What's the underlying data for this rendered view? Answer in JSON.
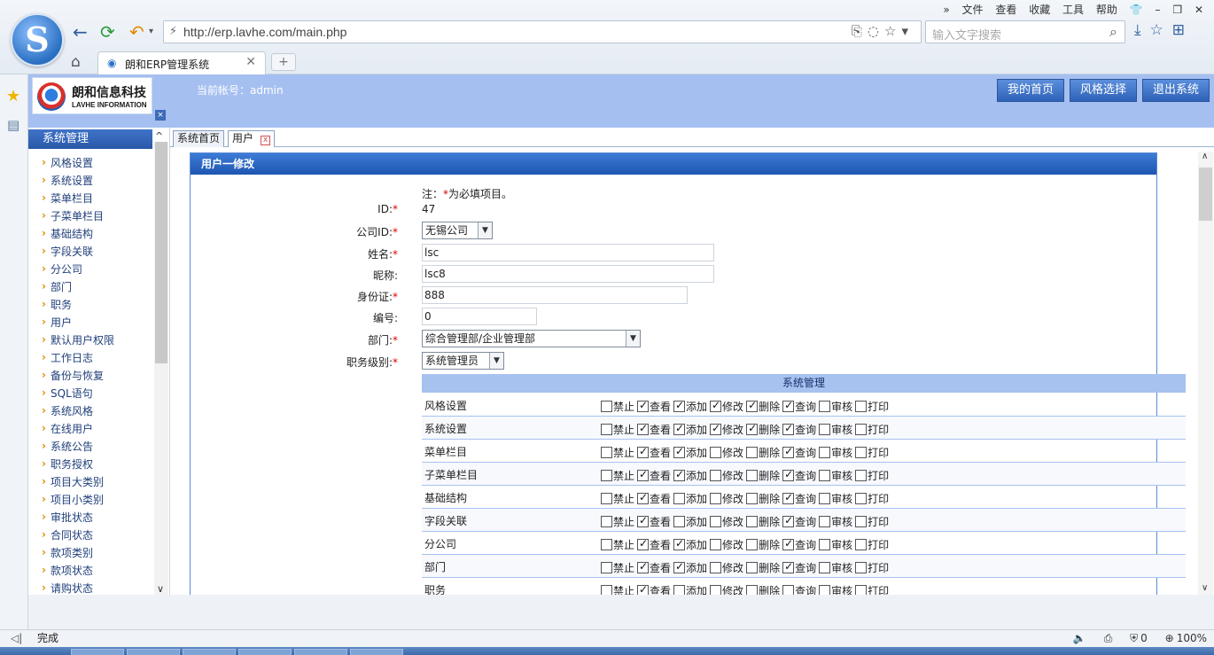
{
  "browser": {
    "url": "http://erp.lavhe.com/main.php",
    "search_placeholder": "输入文字搜索",
    "tab_title": "朗和ERP管理系统",
    "menu": [
      "»",
      "文件",
      "查看",
      "收藏",
      "工具",
      "帮助"
    ],
    "status_text": "完成",
    "status_count": "0",
    "zoom": "100%"
  },
  "app": {
    "brand_cn": "朗和信息科技",
    "brand_en": "LAVHE INFORMATION",
    "account": "当前帐号：admin",
    "header_buttons": [
      "我的首页",
      "风格选择",
      "退出系统"
    ],
    "menu_title": "系统管理",
    "menu_items": [
      "风格设置",
      "系统设置",
      "菜单栏目",
      "子菜单栏目",
      "基础结构",
      "字段关联",
      "分公司",
      "部门",
      "职务",
      "用户",
      "默认用户权限",
      "工作日志",
      "备份与恢复",
      "SQL语句",
      "系统风格",
      "在线用户",
      "系统公告",
      "职务授权",
      "项目大类别",
      "项目小类别",
      "审批状态",
      "合同状态",
      "款项类别",
      "款项状态",
      "请购状态"
    ],
    "content_tabs": [
      "系统首页",
      "用户"
    ]
  },
  "form": {
    "title": "用户一修改",
    "note_prefix": "注：",
    "note_star": "*",
    "note_suffix": "为必填项目。",
    "fields": {
      "id": {
        "label": "ID:",
        "value": "47"
      },
      "company": {
        "label": "公司ID:",
        "value": "无锡公司"
      },
      "name": {
        "label": "姓名:",
        "value": "lsc"
      },
      "nickname": {
        "label": "昵称:",
        "value": "lsc8"
      },
      "idcard": {
        "label": "身份证:",
        "value": "888"
      },
      "number": {
        "label": "编号:",
        "value": "0"
      },
      "department": {
        "label": "部门:",
        "value": "综合管理部/企业管理部"
      },
      "level": {
        "label": "职务级别:",
        "value": "系统管理员"
      }
    },
    "required_mark": "*"
  },
  "permissions": {
    "group_title": "系统管理",
    "columns": [
      "禁止",
      "查看",
      "添加",
      "修改",
      "删除",
      "查询",
      "审核",
      "打印"
    ],
    "rows": [
      {
        "name": "风格设置",
        "checked": [
          false,
          true,
          true,
          true,
          true,
          true,
          false,
          false
        ]
      },
      {
        "name": "系统设置",
        "checked": [
          false,
          true,
          true,
          true,
          true,
          true,
          false,
          false
        ]
      },
      {
        "name": "菜单栏目",
        "checked": [
          false,
          true,
          true,
          false,
          false,
          true,
          false,
          false
        ]
      },
      {
        "name": "子菜单栏目",
        "checked": [
          false,
          true,
          true,
          false,
          false,
          true,
          false,
          false
        ]
      },
      {
        "name": "基础结构",
        "checked": [
          false,
          true,
          false,
          false,
          false,
          true,
          false,
          false
        ]
      },
      {
        "name": "字段关联",
        "checked": [
          false,
          true,
          false,
          false,
          false,
          true,
          false,
          false
        ]
      },
      {
        "name": "分公司",
        "checked": [
          false,
          true,
          true,
          false,
          false,
          true,
          false,
          false
        ]
      },
      {
        "name": "部门",
        "checked": [
          false,
          true,
          true,
          false,
          false,
          true,
          false,
          false
        ]
      },
      {
        "name": "职务",
        "checked": [
          false,
          true,
          false,
          false,
          false,
          false,
          false,
          false
        ]
      }
    ]
  }
}
